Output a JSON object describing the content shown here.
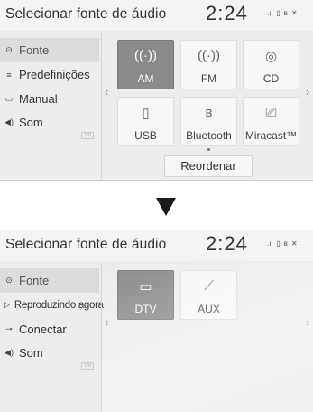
{
  "top_screen": {
    "title": "Selecionar fonte de áudio",
    "clock": "2:24",
    "sidebar": [
      {
        "label": "Fonte",
        "icon": "source-icon",
        "glyph": "⊙"
      },
      {
        "label": "Predefinições",
        "icon": "presets-icon",
        "glyph": "≡"
      },
      {
        "label": "Manual",
        "icon": "manual-icon",
        "glyph": "▭"
      },
      {
        "label": "Som",
        "icon": "sound-icon",
        "glyph": "◀)"
      }
    ],
    "sidebar_badge": "1/6",
    "tiles": [
      {
        "label": "AM",
        "icon": "radio-antenna-icon",
        "glyph": "((·))",
        "active": true
      },
      {
        "label": "FM",
        "icon": "radio-antenna-icon",
        "glyph": "((·))",
        "active": false
      },
      {
        "label": "CD",
        "icon": "cd-icon",
        "glyph": "◎",
        "active": false
      },
      {
        "label": "USB",
        "icon": "usb-icon",
        "glyph": "▯",
        "active": false
      },
      {
        "label": "Bluetooth",
        "icon": "bluetooth-icon",
        "glyph": "ʙ",
        "active": false
      },
      {
        "label": "Miracast™",
        "icon": "miracast-icon",
        "glyph": "⎚",
        "active": false
      }
    ],
    "reorder_label": "Reordenar"
  },
  "bottom_screen": {
    "title": "Selecionar fonte de áudio",
    "clock": "2:24",
    "sidebar": [
      {
        "label": "Fonte",
        "icon": "source-icon",
        "glyph": "⊙"
      },
      {
        "label": "Reproduzindo agora",
        "icon": "play-icon",
        "glyph": "▷"
      },
      {
        "label": "Conectar",
        "icon": "connect-icon",
        "glyph": "⊸"
      },
      {
        "label": "Som",
        "icon": "sound-icon",
        "glyph": "◀)"
      }
    ],
    "sidebar_badge": "1/6",
    "tiles": [
      {
        "label": "DTV",
        "icon": "tv-icon",
        "glyph": "▭",
        "active": true
      },
      {
        "label": "AUX",
        "icon": "aux-cable-icon",
        "glyph": "⟋",
        "active": false
      }
    ]
  }
}
